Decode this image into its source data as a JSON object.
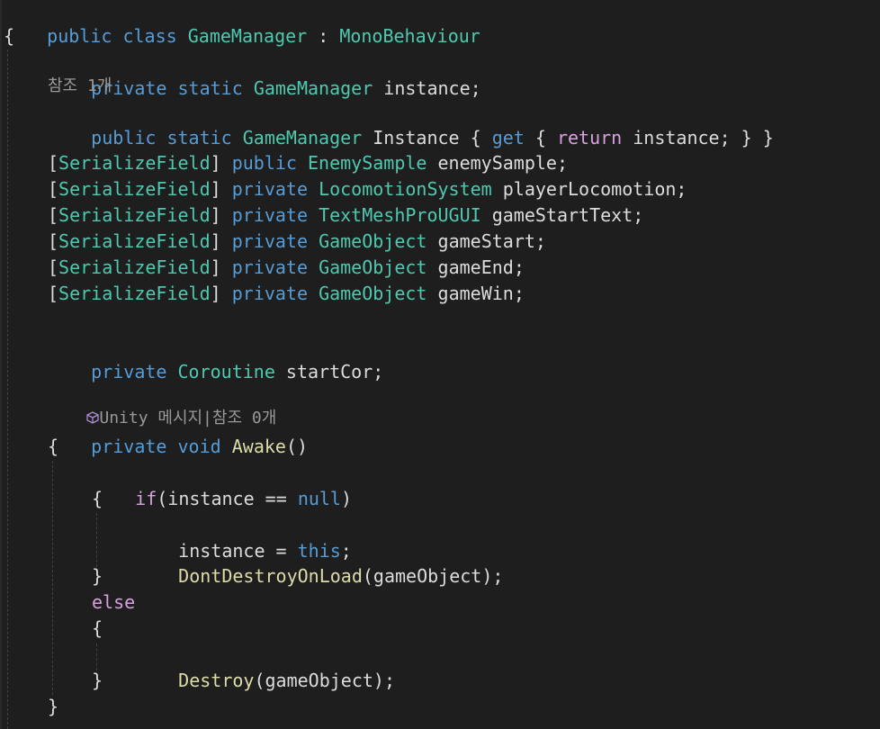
{
  "editor": {
    "lines": {
      "class_decl": {
        "kw1": "public",
        "kw2": "class",
        "name": "GameManager",
        "sep": " : ",
        "base": "MonoBehaviour"
      },
      "open_class": "{",
      "field_instance": {
        "kw1": "private",
        "kw2": "static",
        "type": "GameManager",
        "rest": " instance;"
      },
      "lens_refs_1": "참조 1개",
      "prop_instance": {
        "kw1": "public",
        "kw2": "static",
        "type": "GameManager",
        "name": " Instance { ",
        "get": "get",
        "brace": " { ",
        "ret": "return",
        "rest": " instance; } }"
      },
      "sf1": {
        "attr": "SerializeField",
        "kw": "public",
        "type": "EnemySample",
        "rest": " enemySample;"
      },
      "sf2": {
        "attr": "SerializeField",
        "kw": "private",
        "type": "LocomotionSystem",
        "rest": " playerLocomotion;"
      },
      "sf3": {
        "attr": "SerializeField",
        "kw": "private",
        "type": "TextMeshProUGUI",
        "rest": " gameStartText;"
      },
      "sf4": {
        "attr": "SerializeField",
        "kw": "private",
        "type": "GameObject",
        "rest": " gameStart;"
      },
      "sf5": {
        "attr": "SerializeField",
        "kw": "private",
        "type": "GameObject",
        "rest": " gameEnd;"
      },
      "sf6": {
        "attr": "SerializeField",
        "kw": "private",
        "type": "GameObject",
        "rest": " gameWin;"
      },
      "cor": {
        "kw": "private",
        "type": "Coroutine",
        "rest": " startCor;"
      },
      "lens_unity": "Unity 메시지|참조 0개",
      "awake": {
        "kw1": "private",
        "kw2": "void",
        "name": "Awake",
        "rest": "()"
      },
      "open_awake": "{",
      "if_line": {
        "kw": "if",
        "mid": "(instance == ",
        "nul": "null",
        "end": ")"
      },
      "open_if": "{",
      "assign": {
        "pre": "instance = ",
        "kw": "this",
        "end": ";"
      },
      "ddol": {
        "name": "DontDestroyOnLoad",
        "rest": "(gameObject);"
      },
      "close_if": "}",
      "else_kw": "else",
      "open_else": "{",
      "destroy": {
        "name": "Destroy",
        "rest": "(gameObject);"
      },
      "close_else": "}",
      "close_awake": "}"
    }
  }
}
